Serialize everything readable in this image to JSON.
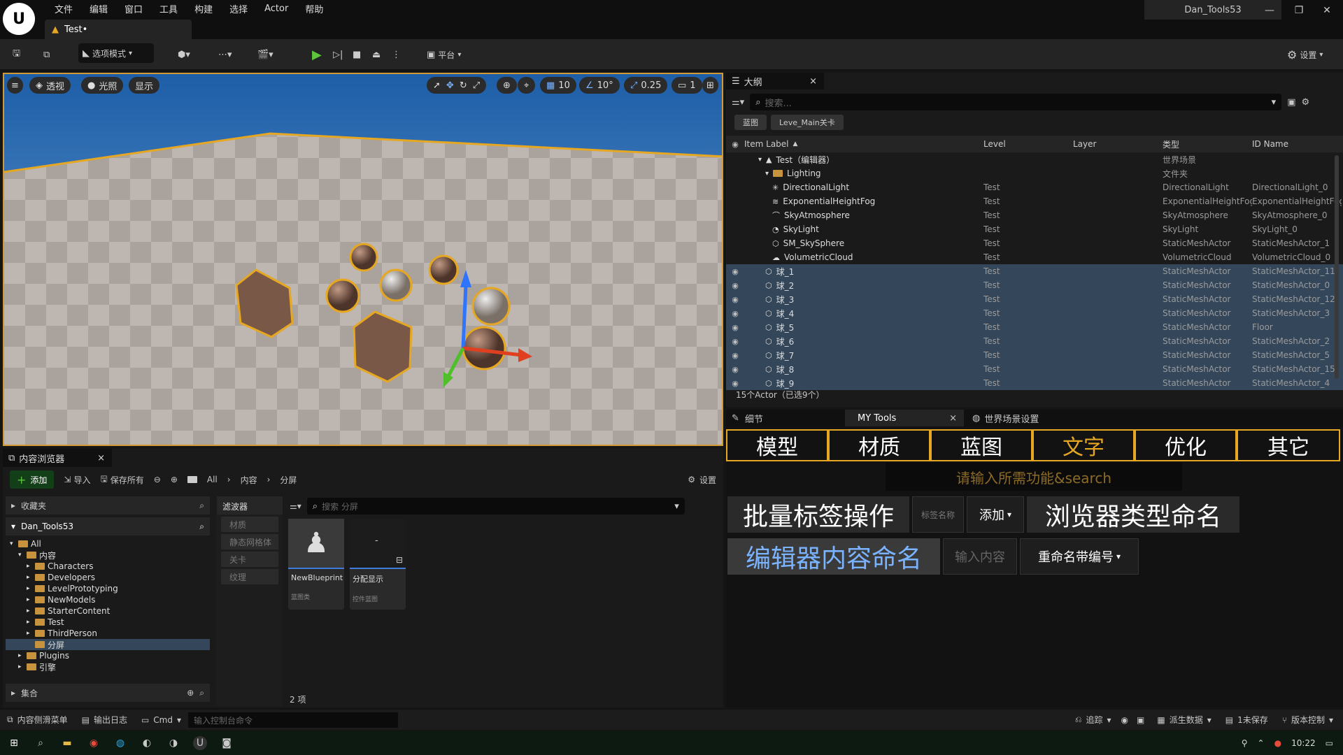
{
  "app": {
    "logo_text": "U",
    "window_title": "Dan_Tools53",
    "doc_tab": "Test•"
  },
  "menu": [
    "文件",
    "编辑",
    "窗口",
    "工具",
    "构建",
    "选择",
    "Actor",
    "帮助"
  ],
  "toolbar": {
    "mode_label": "选项模式",
    "platform_label": "平台",
    "settings_label": "设置"
  },
  "viewport": {
    "perspective": "透视",
    "lighting": "光照",
    "show": "显示",
    "grid_snap": "10",
    "angle_snap": "10°",
    "scale_snap": "0.25",
    "camera_speed": "1"
  },
  "outliner": {
    "title": "大纲",
    "search_placeholder": "搜索...",
    "chips": [
      "蓝图",
      "Leve_Main关卡"
    ],
    "columns": [
      "Item Label",
      "Level",
      "Layer",
      "类型",
      "ID Name"
    ],
    "rows": [
      {
        "label": "Test（编辑器）",
        "level": "",
        "type": "世界场景",
        "id": "",
        "indent": 2,
        "icon": "world-icon",
        "eye": false,
        "sel": false
      },
      {
        "label": "Lighting",
        "level": "",
        "type": "文件夹",
        "id": "",
        "indent": 3,
        "icon": "folder-icon",
        "eye": false,
        "sel": false
      },
      {
        "label": "DirectionalLight",
        "level": "Test",
        "type": "DirectionalLight",
        "id": "DirectionalLight_0",
        "indent": 4,
        "icon": "light-icon",
        "eye": false,
        "sel": false
      },
      {
        "label": "ExponentialHeightFog",
        "level": "Test",
        "type": "ExponentialHeightFog",
        "id": "ExponentialHeightFog",
        "indent": 4,
        "icon": "fog-icon",
        "eye": false,
        "sel": false
      },
      {
        "label": "SkyAtmosphere",
        "level": "Test",
        "type": "SkyAtmosphere",
        "id": "SkyAtmosphere_0",
        "indent": 4,
        "icon": "sky-icon",
        "eye": false,
        "sel": false
      },
      {
        "label": "SkyLight",
        "level": "Test",
        "type": "SkyLight",
        "id": "SkyLight_0",
        "indent": 4,
        "icon": "skylight-icon",
        "eye": false,
        "sel": false
      },
      {
        "label": "SM_SkySphere",
        "level": "Test",
        "type": "StaticMeshActor",
        "id": "StaticMeshActor_1",
        "indent": 4,
        "icon": "mesh-icon",
        "eye": false,
        "sel": false
      },
      {
        "label": "VolumetricCloud",
        "level": "Test",
        "type": "VolumetricCloud",
        "id": "VolumetricCloud_0",
        "indent": 4,
        "icon": "cloud-icon",
        "eye": false,
        "sel": false
      },
      {
        "label": "球_1",
        "level": "Test",
        "type": "StaticMeshActor",
        "id": "StaticMeshActor_11",
        "indent": 3,
        "icon": "mesh-icon",
        "eye": true,
        "sel": true
      },
      {
        "label": "球_2",
        "level": "Test",
        "type": "StaticMeshActor",
        "id": "StaticMeshActor_0",
        "indent": 3,
        "icon": "mesh-icon",
        "eye": true,
        "sel": true
      },
      {
        "label": "球_3",
        "level": "Test",
        "type": "StaticMeshActor",
        "id": "StaticMeshActor_12",
        "indent": 3,
        "icon": "mesh-icon",
        "eye": true,
        "sel": true
      },
      {
        "label": "球_4",
        "level": "Test",
        "type": "StaticMeshActor",
        "id": "StaticMeshActor_3",
        "indent": 3,
        "icon": "mesh-icon",
        "eye": true,
        "sel": true
      },
      {
        "label": "球_5",
        "level": "Test",
        "type": "StaticMeshActor",
        "id": "Floor",
        "indent": 3,
        "icon": "mesh-icon",
        "eye": true,
        "sel": true
      },
      {
        "label": "球_6",
        "level": "Test",
        "type": "StaticMeshActor",
        "id": "StaticMeshActor_2",
        "indent": 3,
        "icon": "mesh-icon",
        "eye": true,
        "sel": true
      },
      {
        "label": "球_7",
        "level": "Test",
        "type": "StaticMeshActor",
        "id": "StaticMeshActor_5",
        "indent": 3,
        "icon": "mesh-icon",
        "eye": true,
        "sel": true
      },
      {
        "label": "球_8",
        "level": "Test",
        "type": "StaticMeshActor",
        "id": "StaticMeshActor_15",
        "indent": 3,
        "icon": "mesh-icon",
        "eye": true,
        "sel": true
      },
      {
        "label": "球_9",
        "level": "Test",
        "type": "StaticMeshActor",
        "id": "StaticMeshActor_4",
        "indent": 3,
        "icon": "mesh-icon",
        "eye": true,
        "sel": true
      }
    ],
    "footer": "15个Actor（已选9个）"
  },
  "details_tabs": {
    "details": "细节",
    "mytools": "MY Tools",
    "world": "世界场景设置"
  },
  "mytools": {
    "tabs": [
      "模型",
      "材质",
      "蓝图",
      "文字",
      "优化",
      "其它"
    ],
    "active_tab": "文字",
    "search_placeholder": "请输入所需功能&search",
    "batch_tag": "批量标签操作",
    "tag_name_placeholder": "标签名称",
    "add_dropdown": "添加",
    "browser_rename": "浏览器类型命名",
    "editor_rename": "编辑器内容命名",
    "input_placeholder": "输入内容",
    "rename_numbered": "重命名带编号"
  },
  "content_browser": {
    "title": "内容浏览器",
    "add": "添加",
    "import": "导入",
    "save_all": "保存所有",
    "path": [
      "All",
      "内容",
      "分屏"
    ],
    "settings": "设置",
    "favorites": "收藏夹",
    "project": "Dan_Tools53",
    "tree": [
      {
        "label": "All",
        "indent": 0,
        "open": true,
        "sel": false
      },
      {
        "label": "内容",
        "indent": 1,
        "open": true,
        "sel": false
      },
      {
        "label": "Characters",
        "indent": 2,
        "open": false,
        "sel": false
      },
      {
        "label": "Developers",
        "indent": 2,
        "open": false,
        "sel": false
      },
      {
        "label": "LevelPrototyping",
        "indent": 2,
        "open": false,
        "sel": false
      },
      {
        "label": "NewModels",
        "indent": 2,
        "open": false,
        "sel": false
      },
      {
        "label": "StarterContent",
        "indent": 2,
        "open": false,
        "sel": false
      },
      {
        "label": "Test",
        "indent": 2,
        "open": false,
        "sel": false
      },
      {
        "label": "ThirdPerson",
        "indent": 2,
        "open": false,
        "sel": false
      },
      {
        "label": "分屏",
        "indent": 2,
        "open": false,
        "sel": true
      },
      {
        "label": "Plugins",
        "indent": 1,
        "open": false,
        "sel": false
      },
      {
        "label": "引擎",
        "indent": 1,
        "open": false,
        "sel": false
      }
    ],
    "collections": "集合",
    "filters_title": "滤波器",
    "filters": [
      "材质",
      "静态网格体",
      "关卡",
      "纹理"
    ],
    "search_placeholder": "搜索 分屏",
    "assets": [
      {
        "name": "NewBlueprint",
        "type": "蓝图类"
      },
      {
        "name": "分配显示",
        "type": "控件蓝图"
      }
    ],
    "count": "2 项"
  },
  "statusbar": {
    "drawer": "内容侧滑菜单",
    "output": "输出日志",
    "cmd": "Cmd",
    "console_placeholder": "输入控制台命令",
    "trace": "追踪",
    "derived": "派生数据",
    "unsaved": "1未保存",
    "source_control": "版本控制"
  },
  "taskbar": {
    "time": "10:22"
  },
  "colors": {
    "accent": "#e6a722",
    "selection": "#34465a",
    "blue_text": "#7ab3ff"
  }
}
